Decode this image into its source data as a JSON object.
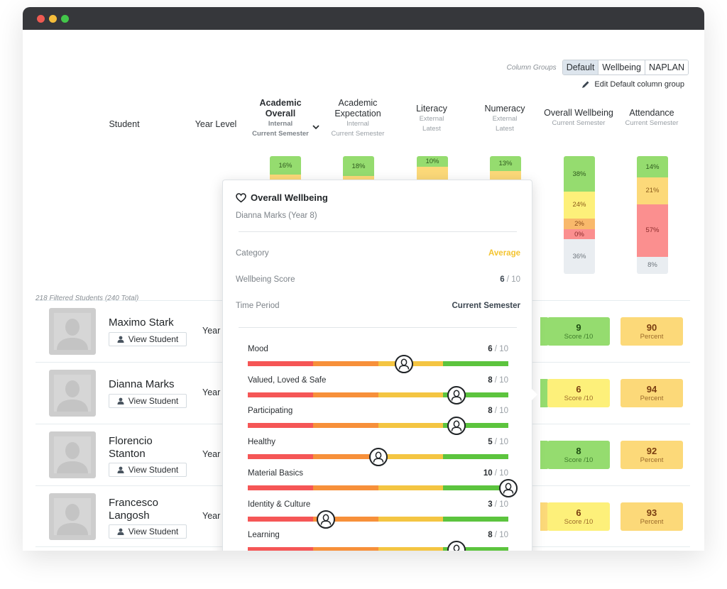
{
  "column_groups": {
    "label": "Column Groups",
    "options": [
      "Default",
      "Wellbeing",
      "NAPLAN"
    ],
    "active": "Default",
    "edit_label": "Edit Default column group"
  },
  "headers": {
    "student": "Student",
    "year_level": "Year Level",
    "academic_overall": {
      "title": "Academic Overall",
      "sub1": "Internal",
      "sub2": "Current Semester"
    },
    "academic_expectation": {
      "title": "Academic Expectation",
      "sub1": "Internal",
      "sub2": "Current Semester"
    },
    "literacy": {
      "title": "Literacy",
      "sub1": "External",
      "sub2": "Latest"
    },
    "numeracy": {
      "title": "Numeracy",
      "sub1": "External",
      "sub2": "Latest"
    },
    "overall_wellbeing": {
      "title": "Overall Wellbeing",
      "sub1": "Current Semester"
    },
    "attendance": {
      "title": "Attendance",
      "sub1": "Current Semester"
    }
  },
  "distribution": {
    "academic_overall": [
      {
        "label": "16%",
        "color": "#95dc6f"
      }
    ],
    "academic_expectation": [
      {
        "label": "18%",
        "color": "#95dc6f"
      }
    ],
    "literacy": [
      {
        "label": "10%",
        "color": "#95dc6f"
      }
    ],
    "numeracy": [
      {
        "label": "13%",
        "color": "#95dc6f"
      }
    ],
    "overall_wellbeing": [
      {
        "label": "38%",
        "value": 38,
        "color": "#95dc6f",
        "text": "#2f5a1e"
      },
      {
        "label": "24%",
        "value": 24,
        "color": "#fdf07a",
        "text": "#8a5a1a"
      },
      {
        "label": "2%",
        "value": 2,
        "color": "#f9b96b",
        "text": "#8a4a1a"
      },
      {
        "label": "0%",
        "value": 0,
        "color": "#fb8f8f",
        "text": "#8a2a2a"
      },
      {
        "label": "36%",
        "value": 36,
        "color": "#e9edf1",
        "text": "#6d757c"
      }
    ],
    "attendance": [
      {
        "label": "14%",
        "value": 14,
        "color": "#95dc6f",
        "text": "#2f5a1e"
      },
      {
        "label": "21%",
        "value": 21,
        "color": "#fcd979",
        "text": "#8a5a1a"
      },
      {
        "label": "57%",
        "value": 57,
        "color": "#fb8f8f",
        "text": "#8a2a2a"
      },
      {
        "label": "8%",
        "value": 8,
        "color": "#e9edf1",
        "text": "#6d757c"
      }
    ]
  },
  "filtered_text": "218 Filtered Students (240 Total)",
  "view_student_label": "View Student",
  "year_prefix": "Year",
  "students": [
    {
      "name": "Maximo Stark",
      "numeracy_color": "green",
      "wellbeing": {
        "score": "9",
        "unit": "Score /10",
        "color": "green"
      },
      "attendance": {
        "value": "90",
        "unit": "Percent",
        "color": "amber"
      }
    },
    {
      "name": "Dianna Marks",
      "numeracy_color": "green",
      "wellbeing": {
        "score": "6",
        "unit": "Score /10",
        "color": "yellow"
      },
      "attendance": {
        "value": "94",
        "unit": "Percent",
        "color": "amber"
      }
    },
    {
      "name": "Florencio Stanton",
      "numeracy_color": "green",
      "wellbeing": {
        "score": "8",
        "unit": "Score /10",
        "color": "green"
      },
      "attendance": {
        "value": "92",
        "unit": "Percent",
        "color": "amber"
      }
    },
    {
      "name": "Francesco Langosh",
      "numeracy_color": "amber",
      "wellbeing": {
        "score": "6",
        "unit": "Score /10",
        "color": "yellow"
      },
      "attendance": {
        "value": "93",
        "unit": "Percent",
        "color": "amber"
      }
    }
  ],
  "popover": {
    "title": "Overall Wellbeing",
    "subtitle": "Dianna Marks (Year 8)",
    "category_label": "Category",
    "category_value": "Average",
    "score_label": "Wellbeing Score",
    "score_value": "6",
    "score_den": " / 10",
    "period_label": "Time Period",
    "period_value": "Current Semester",
    "metrics": [
      {
        "name": "Mood",
        "score": 6
      },
      {
        "name": "Valued, Loved & Safe",
        "score": 8
      },
      {
        "name": "Participating",
        "score": 8
      },
      {
        "name": "Healthy",
        "score": 5
      },
      {
        "name": "Material Basics",
        "score": 10
      },
      {
        "name": "Identity & Culture",
        "score": 3
      },
      {
        "name": "Learning",
        "score": 8
      }
    ],
    "metric_max": 10,
    "den_text": " / 10",
    "track_colors": [
      "#f55656",
      "#f7903a",
      "#f4c542",
      "#5cc43e"
    ]
  }
}
